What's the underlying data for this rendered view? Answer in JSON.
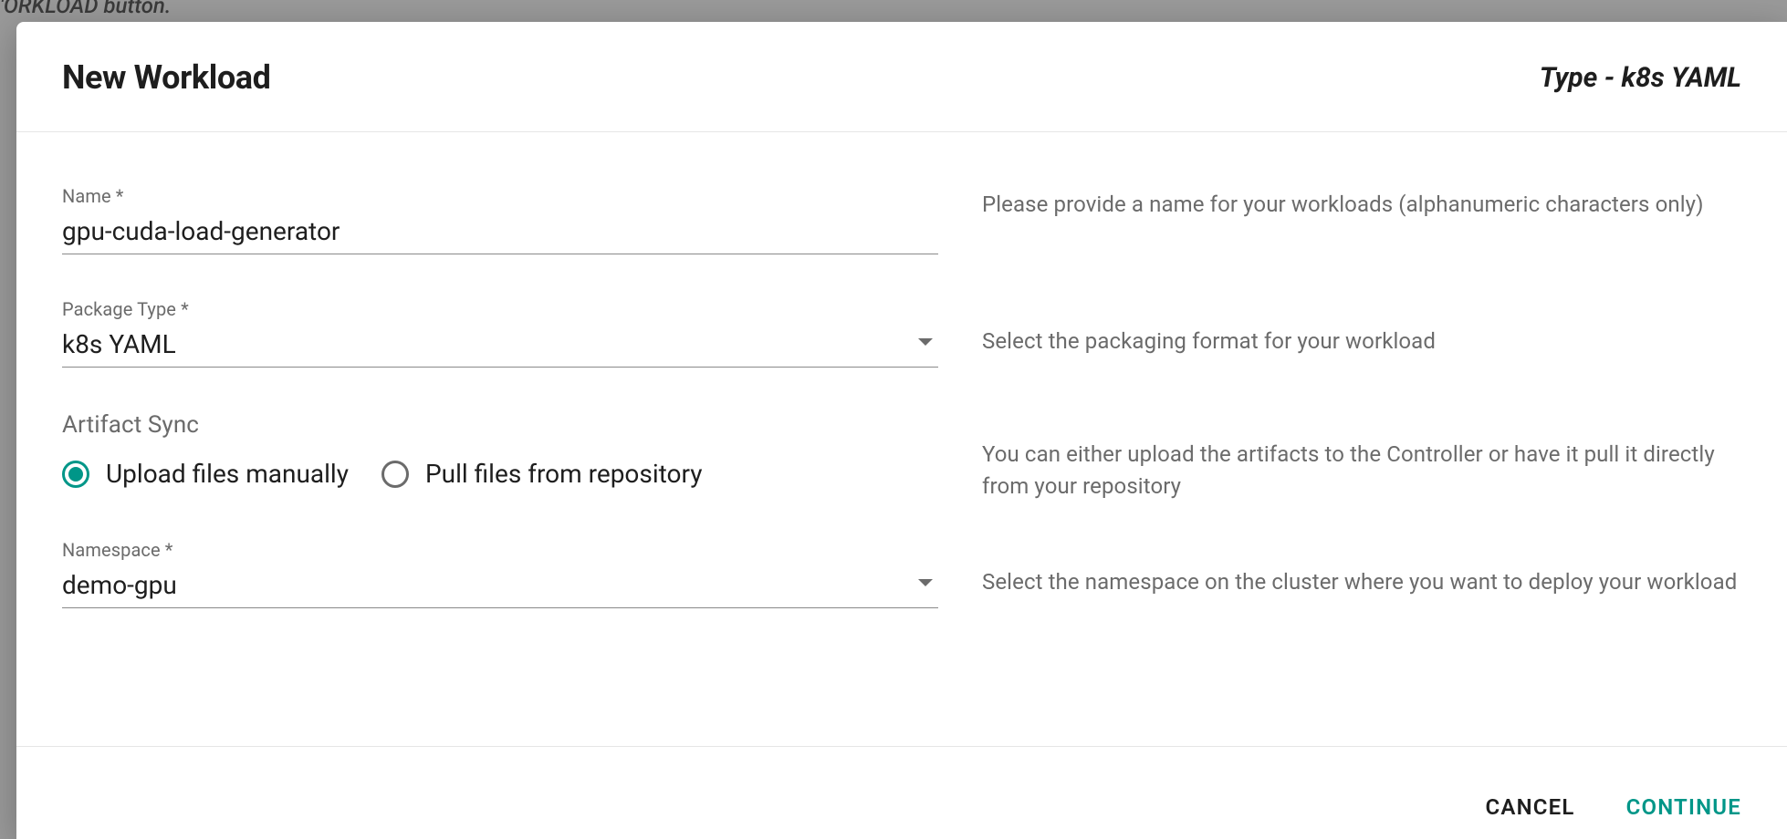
{
  "backdrop": {
    "partial_text": "'ORKLOAD button."
  },
  "modal": {
    "title": "New Workload",
    "type_label": "Type - k8s YAML",
    "fields": {
      "name": {
        "label": "Name *",
        "value": "gpu-cuda-load-generator",
        "helper": "Please provide a name for your workloads (alphanumeric characters only)"
      },
      "package_type": {
        "label": "Package Type *",
        "value": "k8s YAML",
        "helper": "Select the packaging format for your workload"
      },
      "artifact_sync": {
        "section_label": "Artifact Sync",
        "options": [
          {
            "label": "Upload files manually",
            "selected": true
          },
          {
            "label": "Pull files from repository",
            "selected": false
          }
        ],
        "helper": "You can either upload the artifacts to the Controller or have it pull it directly from your repository"
      },
      "namespace": {
        "label": "Namespace *",
        "value": "demo-gpu",
        "helper": "Select the namespace on the cluster where you want to deploy your workload"
      }
    },
    "footer": {
      "cancel": "CANCEL",
      "continue": "CONTINUE"
    }
  }
}
